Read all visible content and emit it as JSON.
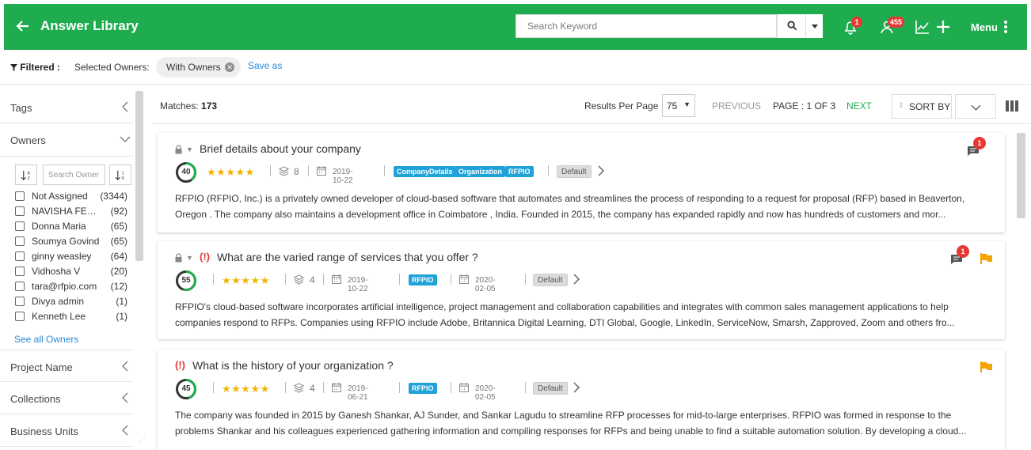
{
  "header": {
    "title": "Answer Library",
    "search_placeholder": "Search Keyword",
    "notification_count": "1",
    "users_count": "455",
    "menu_label": "Menu",
    "bg_color": "#1fac4f"
  },
  "filter_bar": {
    "filtered_label": "Filtered :",
    "selected_owners_label": "Selected Owners:",
    "chip_label": "With Owners",
    "save_as": "Save as"
  },
  "sidebar": {
    "tags_label": "Tags",
    "owners_label": "Owners",
    "owner_search_placeholder": "Search Owner",
    "owners": [
      {
        "name": "Not Assigned",
        "count": "(3344)"
      },
      {
        "name": "NAVISHA FERNANDES",
        "count": "(92)"
      },
      {
        "name": "Donna Maria",
        "count": "(65)"
      },
      {
        "name": "Soumya Govind",
        "count": "(65)"
      },
      {
        "name": "ginny weasley",
        "count": "(64)"
      },
      {
        "name": "Vidhosha V",
        "count": "(20)"
      },
      {
        "name": "tara@rfpio.com",
        "count": "(12)"
      },
      {
        "name": "Divya admin",
        "count": "(1)"
      },
      {
        "name": "Kenneth Lee",
        "count": "(1)"
      }
    ],
    "see_all": "See all Owners",
    "project_name_label": "Project Name",
    "collections_label": "Collections",
    "business_units_label": "Business Units"
  },
  "toolbar": {
    "matches_label": "Matches:",
    "matches_count": "173",
    "results_per_page_label": "Results Per Page",
    "results_per_page": "75",
    "previous": "PREVIOUS",
    "page_info": "PAGE : 1 OF 3",
    "next": "NEXT",
    "sort_by": "SORT BY"
  },
  "results": [
    {
      "title": "Brief details about your company",
      "score": "40",
      "score_fraction": 0.4,
      "stars": "★★★★★",
      "versions": "8",
      "created": "2019-10-22",
      "tags": [
        "CompanyDetails",
        "Organization",
        "RFPIO"
      ],
      "default_label": "Default",
      "comment_count": "1",
      "text": "RFPIO (RFPIO, Inc.) is a privately owned developer of cloud-based software that automates and streamlines the process of responding to a request for proposal (RFP) based in Beaverton, Oregon . The company also maintains a development office in Coimbatore , India. Founded in 2015, the company has expanded rapidly and now has hundreds of customers and mor..."
    },
    {
      "title": "What are the varied range of services that you offer ?",
      "excl": "(!)",
      "score": "55",
      "score_fraction": 0.55,
      "stars": "★★★★★",
      "versions": "4",
      "created": "2019-10-22",
      "tags": [
        "RFPIO"
      ],
      "updated": "2020-02-05",
      "default_label": "Default",
      "comment_count": "1",
      "text": "RFPIO's cloud-based software incorporates artificial intelligence, project management and collaboration capabilities and integrates with common sales management applications to help companies respond to RFPs. Companies using RFPIO include Adobe, Britannica Digital Learning, DTI Global, Google, LinkedIn, ServiceNow, Smarsh, Zapproved, Zoom and others fro..."
    },
    {
      "title": "What is the history of your organization ?",
      "excl": "(!)",
      "score": "45",
      "score_fraction": 0.45,
      "stars": "★★★★★",
      "versions": "4",
      "created": "2019-06-21",
      "tags": [
        "RFPIO"
      ],
      "updated": "2020-02-05",
      "default_label": "Default",
      "text": "The company was founded in 2015 by Ganesh Shankar, AJ Sunder, and Sankar Lagudu to streamline RFP processes for mid-to-large enterprises. RFPIO was formed in response to the problems Shankar and his colleagues experienced gathering information and compiling responses for RFPs and being unable to find a suitable automation solution. By developing a cloud..."
    }
  ]
}
